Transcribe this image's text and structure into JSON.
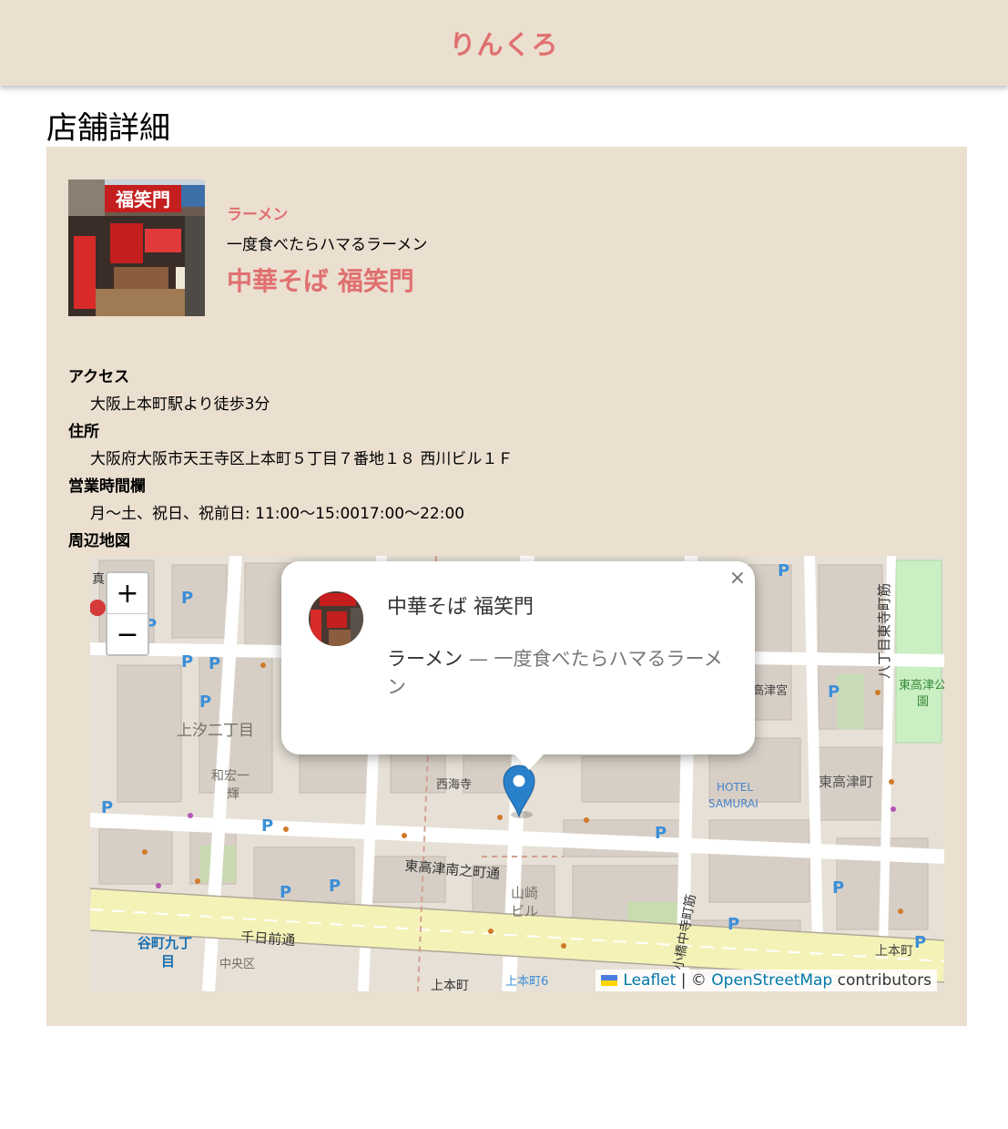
{
  "header": {
    "brand": "りんくろ"
  },
  "page": {
    "title": "店舗詳細"
  },
  "shop": {
    "genre": "ラーメン",
    "catch": "一度食べたらハマるラーメン",
    "name": "中華そば 福笑門",
    "sign_text": "福笑門"
  },
  "details": {
    "access_label": "アクセス",
    "access_value": "大阪上本町駅より徒歩3分",
    "address_label": "住所",
    "address_value": "大阪府大阪市天王寺区上本町５丁目７番地１８ 西川ビル１Ｆ",
    "hours_label": "営業時間欄",
    "hours_value": "月～土、祝日、祝前日: 11:00～15:0017:00～22:00",
    "map_label": "周辺地図"
  },
  "map": {
    "zoom_in": "+",
    "zoom_out": "−",
    "popup": {
      "title": "中華そば 福笑門",
      "genre": "ラーメン",
      "separator": " — ",
      "catch": "一度食べたらハマるラーメン",
      "close": "×"
    },
    "labels": {
      "l1": "上汐二丁目",
      "l2": "和宏一",
      "l3": "輝",
      "l4": "西海寺",
      "l5": "東高津南之町通",
      "l6": "山崎",
      "l7": "ビル",
      "l8": "千日前通",
      "l9": "谷町九丁",
      "l10": "目",
      "l11": "中央区",
      "l12": "上本町",
      "l13": "上本町6",
      "l14": "HOTEL",
      "l15": "SAMURAI",
      "l16": "東高津町",
      "l17": "八丁目東寺町筋",
      "l18": "東高津公",
      "l19": "園",
      "l20": "高津宮",
      "l21": "上本町",
      "l22": "小橋中寺町筋",
      "l23": "真"
    },
    "attribution": {
      "leaflet": "Leaflet",
      "sep": " | © ",
      "osm": "OpenStreetMap",
      "tail": " contributors"
    },
    "colors": {
      "marker": "#2a81cb",
      "water_link": "#0078a8"
    }
  },
  "colors": {
    "accent": "#e07070",
    "panel": "#ebdfd0"
  }
}
